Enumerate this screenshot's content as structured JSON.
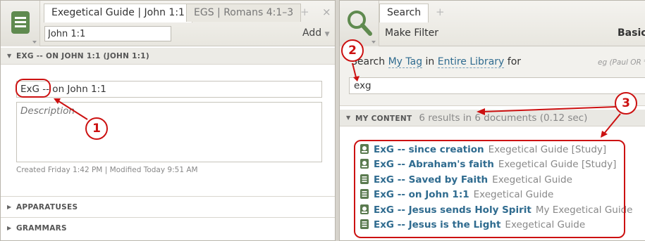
{
  "left": {
    "tabs": [
      {
        "label": "Exegetical Guide | John 1:1"
      },
      {
        "label": "EGS | Romans 4:1–3"
      }
    ],
    "tab_plus": "+",
    "tab_close": "×",
    "reference_value": "John 1:1",
    "add_label": "Add",
    "section_title": "EXG -- ON JOHN 1:1 (JOHN 1:1)",
    "title_value": "ExG -- on John 1:1",
    "description_placeholder": "Description",
    "created_text": "Created Friday 1:42 PM | Modified Today 9:51 AM",
    "sections": [
      {
        "label": "APPARATUSES"
      },
      {
        "label": "GRAMMARS"
      }
    ]
  },
  "right": {
    "tab": "Search",
    "tab_plus": "+",
    "make_filter": "Make Filter",
    "basic": "Basic",
    "search_prefix": "Search",
    "search_scope": "My Tag",
    "search_in": "in",
    "search_library": "Entire Library",
    "search_for": "for",
    "hint": "eg (Paul OR *",
    "query": "exg",
    "results_section": "MY CONTENT",
    "results_summary": "6 results in 6 documents (0.12 sec)",
    "results": [
      {
        "title": "ExG -- since creation",
        "source": "Exegetical Guide [Study]",
        "icon": "study-guide-icon"
      },
      {
        "title": "ExG -- Abraham's faith",
        "source": "Exegetical Guide [Study]",
        "icon": "study-guide-icon"
      },
      {
        "title": "ExG -- Saved by Faith",
        "source": "Exegetical Guide",
        "icon": "guide-icon"
      },
      {
        "title": "ExG -- on John 1:1",
        "source": "Exegetical Guide",
        "icon": "guide-icon"
      },
      {
        "title": "ExG -- Jesus sends Holy Spirit",
        "source": "My Exegetical Guide",
        "icon": "study-guide-icon"
      },
      {
        "title": "ExG -- Jesus is the Light",
        "source": "Exegetical Guide",
        "icon": "guide-icon"
      }
    ]
  },
  "callouts": [
    "1",
    "2",
    "3"
  ],
  "colors": {
    "annotation": "#cc1111",
    "link": "#2f6b8f",
    "icon_green": "#5a7a4f"
  }
}
